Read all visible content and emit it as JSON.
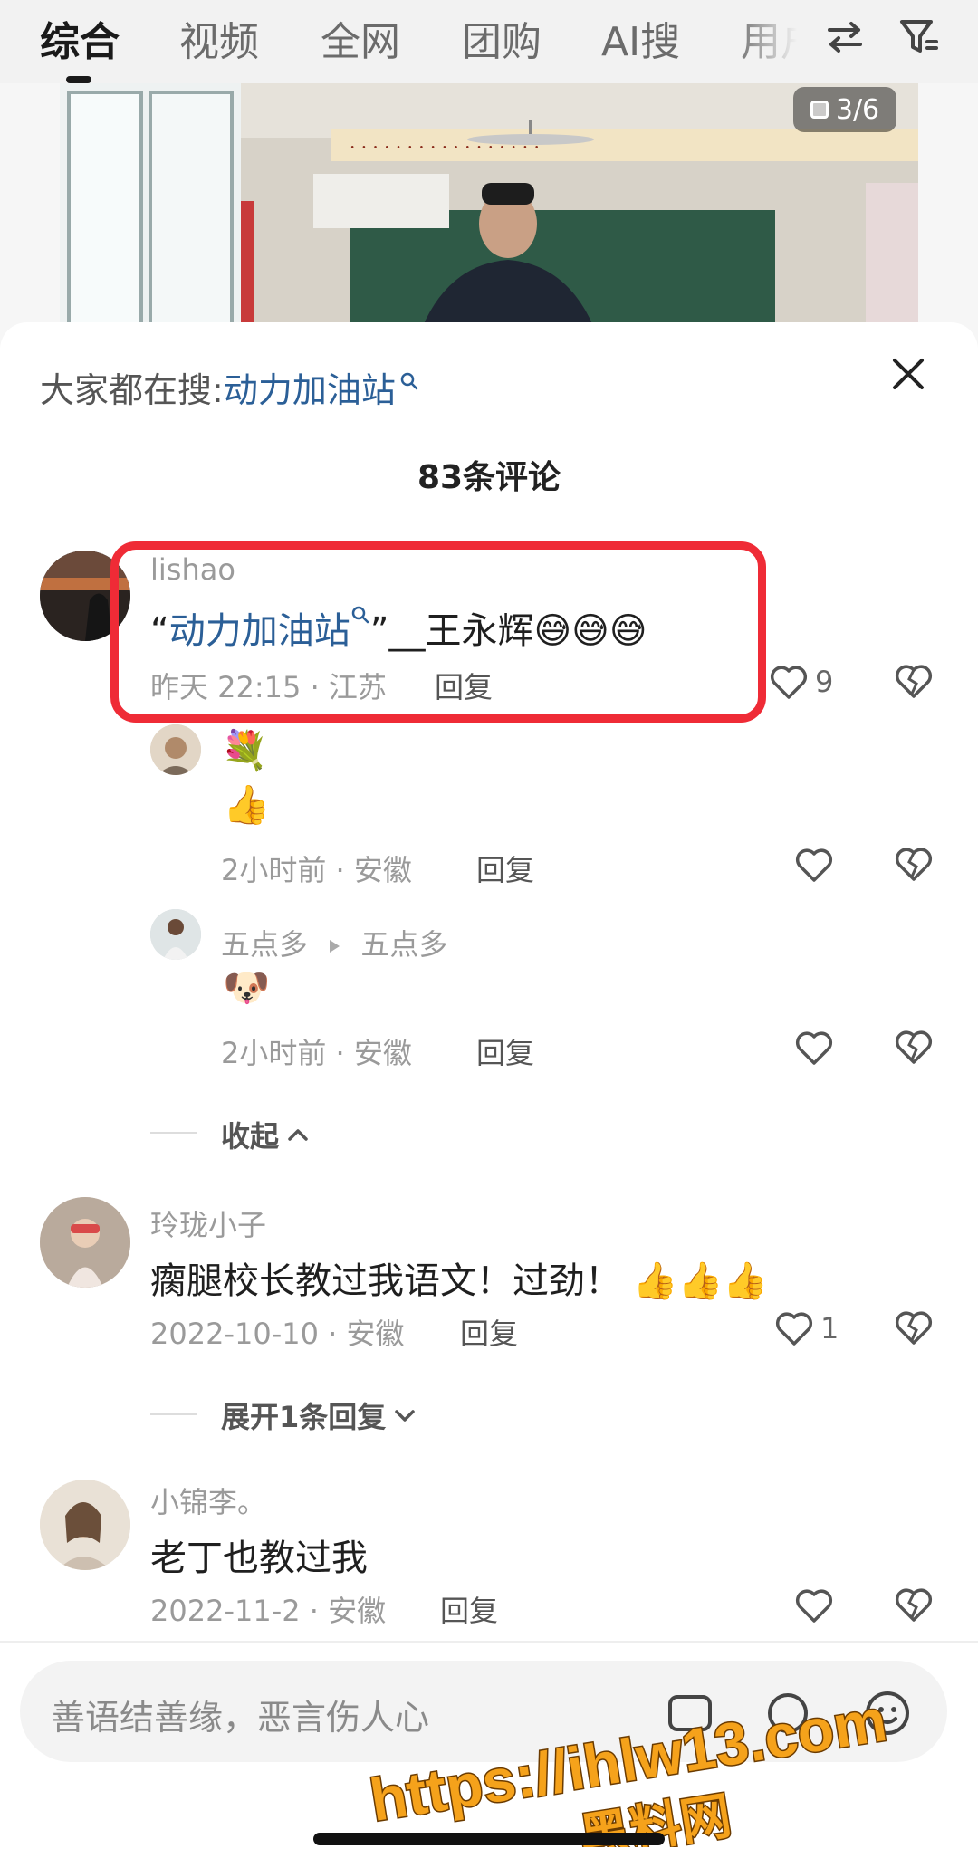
{
  "nav": {
    "tabs": [
      "综合",
      "视频",
      "全网",
      "团购",
      "AI搜",
      "用户"
    ],
    "active_tab": "综合",
    "sort_icon": "swap-icon",
    "filter_icon": "filter-icon"
  },
  "photo": {
    "page_indicator": "3/6"
  },
  "sheet": {
    "search_prefix": "大家都在搜:",
    "search_keyword": "动力加油站",
    "comment_count": "83条评论"
  },
  "comments": [
    {
      "user": "lishao",
      "text_open_quote": "“",
      "text_keyword": "动力加油站",
      "text_rest": "”__王永辉",
      "emojis": "😅😅😅",
      "meta": "昨天 22:15 · 江苏",
      "reply": "回复",
      "likes": "9"
    },
    {
      "user": "",
      "text_line1_emoji": "💐",
      "text_line2_emoji": "👍",
      "meta": "2小时前 · 安徽",
      "reply": "回复"
    },
    {
      "user": "五点多",
      "reply_to": "五点多",
      "emoji": "🐶",
      "meta": "2小时前 · 安徽",
      "reply": "回复"
    },
    {
      "collapse_label": "收起"
    },
    {
      "user": "玲珑小子",
      "text": "瘸腿校长教过我语文！过劲！",
      "emojis": "👍👍👍",
      "meta": "2022-10-10 · 安徽",
      "reply": "回复",
      "likes": "1"
    },
    {
      "expand_label": "展开1条回复"
    },
    {
      "user": "小锦李。",
      "text": "老丁也教过我",
      "meta": "2022-11-2 · 安徽",
      "reply": "回复"
    }
  ],
  "input": {
    "placeholder": "善语结善缘，恶言伤人心"
  },
  "watermark": {
    "line1": "https://ihlw13.com",
    "line2": "黑料网"
  },
  "colors": {
    "accent_link": "#2b5f97",
    "highlight": "#ef2b36",
    "watermark": "#f5a21b"
  }
}
